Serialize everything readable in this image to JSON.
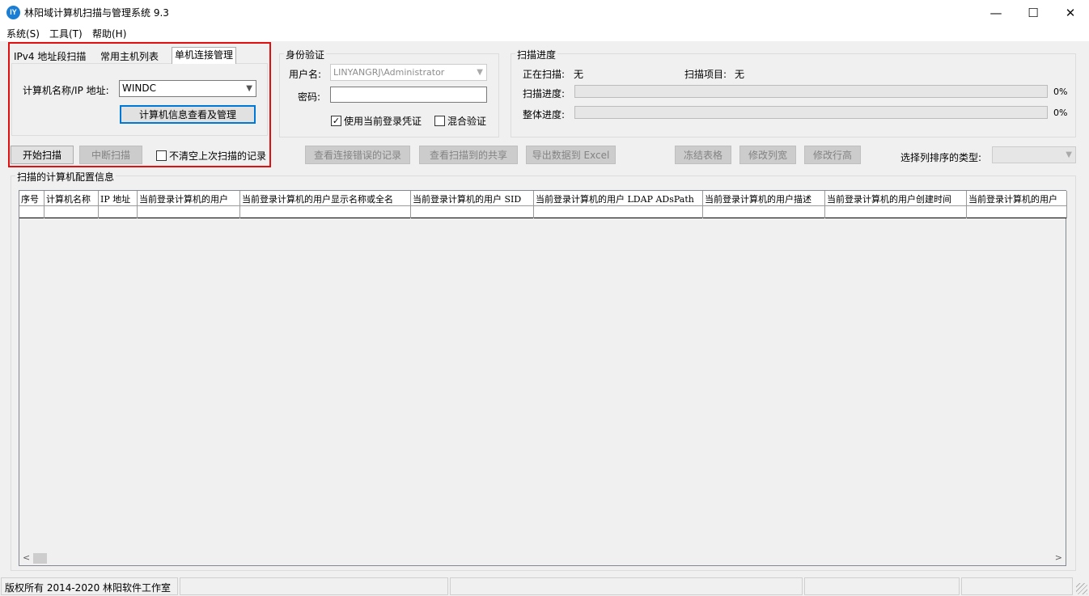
{
  "window": {
    "title": "林阳域计算机扫描与管理系统 9.3",
    "icon_text": "lY",
    "minimize": "—",
    "maximize": "☐",
    "close": "✕"
  },
  "menu": [
    "系统(S)",
    "工具(T)",
    "帮助(H)"
  ],
  "tabs": [
    "IPv4 地址段扫描",
    "常用主机列表",
    "单机连接管理"
  ],
  "host_panel": {
    "label": "计算机名称/IP 地址:",
    "value": "WINDC",
    "manage_button": "计算机信息查看及管理"
  },
  "auth": {
    "group_title": "身份验证",
    "username_label": "用户名:",
    "username_value": "LINYANGRJ\\Administrator",
    "password_label": "密码:",
    "use_current_label": "使用当前登录凭证",
    "use_current_checked": true,
    "mixed_label": "混合验证",
    "mixed_checked": false
  },
  "progress": {
    "group_title": "扫描进度",
    "scanning_label": "正在扫描:",
    "scanning_value": "无",
    "item_label": "扫描项目:",
    "item_value": "无",
    "scan_progress_label": "扫描进度:",
    "scan_progress_pct": "0%",
    "scan_progress_value": 0,
    "total_progress_label": "整体进度:",
    "total_progress_pct": "0%",
    "total_progress_value": 0
  },
  "toolbar": {
    "start": "开始扫描",
    "stop": "中断扫描",
    "keep_records_label": "不清空上次扫描的记录",
    "keep_records_checked": false,
    "view_errors": "查看连接错误的记录",
    "view_shares": "查看扫描到的共享",
    "export_excel": "导出数据到 Excel",
    "freeze": "冻结表格",
    "col_width": "修改列宽",
    "row_height": "修改行高",
    "sort_label": "选择列排序的类型:"
  },
  "grid": {
    "group_title": "扫描的计算机配置信息",
    "columns": [
      "序号",
      "计算机名称",
      "IP 地址",
      "当前登录计算机的用户",
      "当前登录计算机的用户显示名称或全名",
      "当前登录计算机的用户 SID",
      "当前登录计算机的用户 LDAP ADsPath",
      "当前登录计算机的用户描述",
      "当前登录计算机的用户创建时间",
      "当前登录计算机的用户"
    ],
    "scroll_left": "<",
    "scroll_right": ">"
  },
  "status": {
    "copyright": "版权所有 2014-2020 林阳软件工作室"
  }
}
